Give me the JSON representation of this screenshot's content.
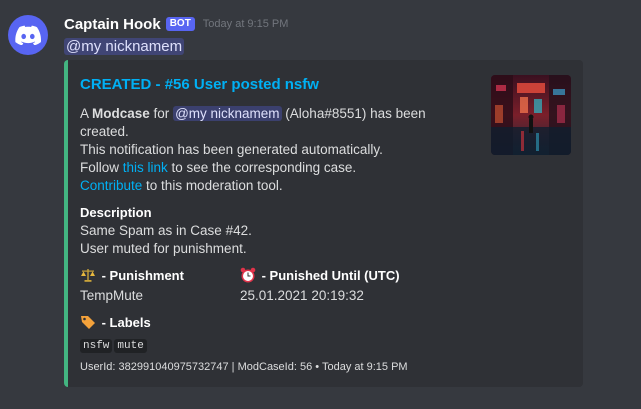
{
  "message": {
    "username": "Captain Hook",
    "bot_tag": "BOT",
    "timestamp": "Today at 9:15 PM",
    "content_mention": "@my nicknamem"
  },
  "embed": {
    "accent_color": "#43b581",
    "title": "CREATED - #56 User posted nsfw",
    "desc": {
      "l1_a": "A ",
      "l1_bold": "Modcase",
      "l1_b": " for ",
      "l1_mention": "@my nicknamem",
      "l1_c": " (Aloha#8551) has been",
      "l2": "created.",
      "l3": "This notification has been generated automatically.",
      "l4_a": "Follow ",
      "l4_link": "this link",
      "l4_b": " to see the corresponding case.",
      "l5_link": "Contribute",
      "l5_b": " to this moderation tool."
    },
    "fields": {
      "description_name": "Description",
      "description_line1": "Same Spam as in Case #42.",
      "description_line2": "User muted for punishment.",
      "punishment_name": " - Punishment",
      "punishment_icon": "scales-icon",
      "punishment_value": "TempMute",
      "until_name": " - Punished Until (UTC)",
      "until_icon": "alarm-clock-icon",
      "until_value": "25.01.2021 20:19:32",
      "labels_name": " - Labels",
      "labels_icon": "label-tag-icon",
      "labels": [
        "nsfw",
        "mute"
      ]
    },
    "footer": "UserId: 382991040975732747 | ModCaseId: 56 • Today at 9:15 PM"
  }
}
